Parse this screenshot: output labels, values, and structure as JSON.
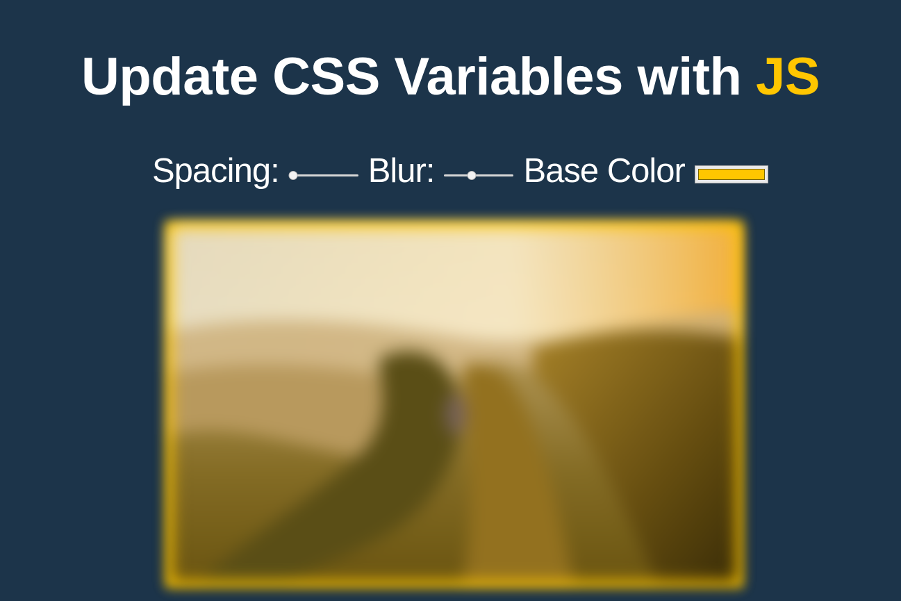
{
  "header": {
    "title_main": "Update CSS Variables with ",
    "title_accent": "JS"
  },
  "controls": {
    "spacing_label": "Spacing:",
    "spacing_value": 10,
    "spacing_min": 10,
    "spacing_max": 200,
    "blur_label": "Blur:",
    "blur_value": 10,
    "blur_min": 0,
    "blur_max": 25,
    "base_color_label": "Base Color",
    "base_color_value": "#ffc600"
  },
  "colors": {
    "background": "#1c344a",
    "accent": "#ffc600"
  },
  "image": {
    "description_icon": "mountain-landscape-photo"
  }
}
